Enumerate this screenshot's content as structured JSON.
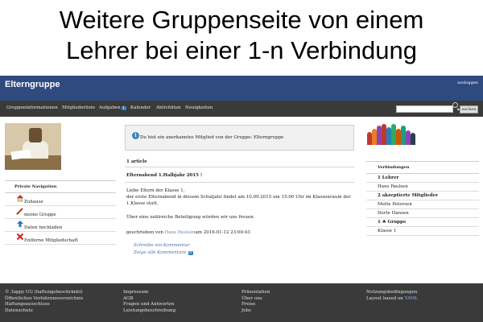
{
  "headline": {
    "line1": "Weitere Gruppenseite von einem",
    "line2": "Lehrer bei einer 1-n Verbindung"
  },
  "header": {
    "app_title": "Elterngruppe",
    "logout": "ausloggen"
  },
  "nav": {
    "items": [
      "Gruppeninformationen",
      "Mitgliederliste",
      "Aufgaben",
      "Kalender",
      "Aktivitäten",
      "Neuigkeiten"
    ],
    "tasks_badge": "1",
    "search_button": "suchen",
    "search_value": ""
  },
  "sidebar": {
    "title": "Private Navigation",
    "items": [
      {
        "label": "Zuhause",
        "icon": "house-icon"
      },
      {
        "label": "meine Gruppe",
        "icon": "pencil-icon"
      },
      {
        "label": "Daten hochladen",
        "icon": "upload-icon"
      },
      {
        "label": "Entferne Mitgliedschaft",
        "icon": "remove-icon"
      }
    ]
  },
  "main": {
    "notice": "Du bist ein anerkanntes Mitglied von der Gruppe: Elterngruppe",
    "article_count": "1 article",
    "article": {
      "title": "Elternabend 1.Halbjahr 2015 !",
      "greeting": "Liebe Eltern der Klasse 1,",
      "line1": "der erste Elternabend in diesem Schuljahr findet am 10.09.2015 um 15:00 Uhr im Klassenraum der",
      "line2": "1.Klasse statt.",
      "line3": "Über eine zahlreiche Beteiligung würden wir uns freuen.",
      "byline_prefix": "geschrieben von ",
      "author": "Hans Paulsen",
      "byline_suffix": "am 2016-01-12 23:00:43",
      "write_comment": "Schreibe ein Kommentar",
      "show_comments": "Zeige alle Kommentare",
      "comment_count": "0"
    }
  },
  "right_panel": {
    "title": "Verbindungen",
    "rows": [
      {
        "text": "1 Lehrer",
        "bold": true
      },
      {
        "text": "Hans Paulsen",
        "bold": false
      },
      {
        "text": "2 akzeptierte Mitglieder",
        "bold": true
      },
      {
        "text": "Mette Petersen",
        "bold": false
      },
      {
        "text": "Dorte Hansen",
        "bold": false
      },
      {
        "text": "1 ♣ Gruppe",
        "bold": true
      },
      {
        "text": "Klasse 1",
        "bold": false
      }
    ]
  },
  "footer": {
    "col1": [
      "© 3appy UG (haftungsbeschränkt)",
      "Öffentliches Verfahrensverzeichnis",
      "Haftungsausschluss",
      "Datenschutz"
    ],
    "col2": [
      "Impressum",
      "AGB",
      "Fragen und Antworten",
      "Leistungsbeschreibung"
    ],
    "col3": [
      "Präsentation",
      "Über uns",
      "Preise",
      "Jobs"
    ],
    "col4": [
      "Nutzungsbedingungen"
    ],
    "layout_prefix": "Layout based on ",
    "layout_link": "YAML"
  },
  "colors": {
    "topbar": "#2f4a7e",
    "navbar": "#3a3a3a",
    "footer": "#3a3a3a",
    "link": "#4a6db3",
    "badge": "#3b82c4"
  }
}
